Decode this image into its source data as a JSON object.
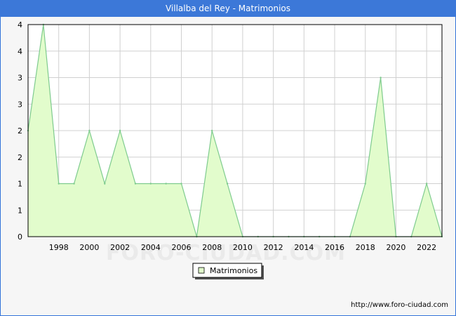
{
  "title": "Villalba del Rey - Matrimonios",
  "watermark": "FORO-CIUDAD.COM",
  "source": "http://www.foro-ciudad.com",
  "colors": {
    "title_bg": "#3c78d8",
    "area_fill": "#e2fccc",
    "line": "#7ecb8e",
    "grid": "#d0d0d0"
  },
  "chart_data": {
    "type": "area",
    "title": "Villalba del Rey - Matrimonios",
    "x": [
      1996,
      1997,
      1998,
      1999,
      2000,
      2001,
      2002,
      2003,
      2004,
      2005,
      2006,
      2007,
      2008,
      2009,
      2010,
      2011,
      2012,
      2013,
      2014,
      2015,
      2016,
      2017,
      2018,
      2019,
      2020,
      2021,
      2022,
      2023
    ],
    "series": [
      {
        "name": "Matrimonios",
        "values": [
          2,
          4,
          1,
          1,
          2,
          1,
          2,
          1,
          1,
          1,
          1,
          0,
          2,
          1,
          0,
          0,
          0,
          0,
          0,
          0,
          0,
          0,
          1,
          3,
          0,
          0,
          1,
          0
        ]
      }
    ],
    "xlim": [
      1996,
      2023
    ],
    "ylim": [
      0,
      4
    ],
    "x_ticks": [
      "1998",
      "2000",
      "2002",
      "2004",
      "2006",
      "2008",
      "2010",
      "2012",
      "2014",
      "2016",
      "2018",
      "2020",
      "2022"
    ],
    "y_ticks": [
      "0",
      "1",
      "1",
      "2",
      "2",
      "3",
      "3",
      "4",
      "4"
    ],
    "y_tick_values": [
      0,
      0.5,
      1,
      1.5,
      2,
      2.5,
      3,
      3.5,
      4
    ],
    "grid": true,
    "legend": "bottom-center"
  }
}
